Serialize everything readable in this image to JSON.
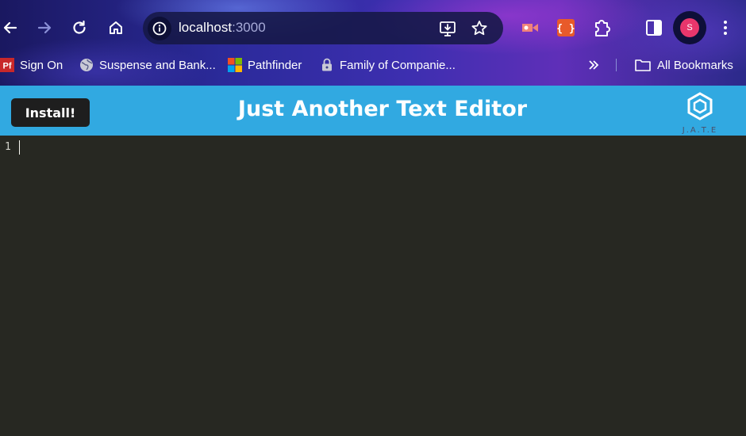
{
  "browser": {
    "url_host": "localhost",
    "url_port": ":3000",
    "profile_initial": "S",
    "nav": {
      "back_icon": "arrow-left-icon",
      "forward_icon": "arrow-right-icon",
      "reload_icon": "reload-icon",
      "home_icon": "home-icon"
    },
    "bookmarks": [
      {
        "label": "Sign On",
        "icon": "pf-logo-icon"
      },
      {
        "label": "Suspense and Bank...",
        "icon": "globe-icon"
      },
      {
        "label": "Pathfinder",
        "icon": "microsoft-logo-icon"
      },
      {
        "label": "Family of Companie...",
        "icon": "lock-icon"
      }
    ],
    "all_bookmarks_label": "All Bookmarks",
    "pf_badge": "Pf"
  },
  "app": {
    "install_label": "Install!",
    "title": "Just Another Text Editor",
    "logo_text": "J.A.T.E",
    "header_color": "#31a9e1"
  },
  "editor": {
    "line_numbers": [
      "1"
    ],
    "background": "#272822"
  }
}
